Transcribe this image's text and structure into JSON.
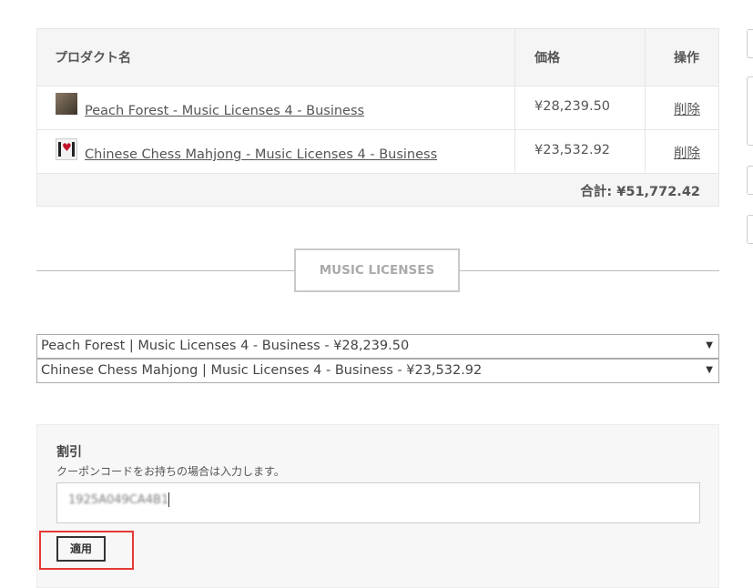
{
  "top_fragment": {
    "left": "",
    "right": ""
  },
  "cart": {
    "headers": {
      "product": "プロダクト名",
      "price": "価格",
      "action": "操作"
    },
    "items": [
      {
        "name": "Peach Forest - Music Licenses 4 - Business",
        "price": "¥28,239.50",
        "action": "削除"
      },
      {
        "name": "Chinese Chess Mahjong - Music Licenses 4 - Business",
        "price": "¥23,532.92",
        "action": "削除"
      }
    ],
    "total": "合計: ¥51,772.42"
  },
  "section": {
    "title": "MUSIC LICENSES"
  },
  "license_selects": [
    {
      "value": "Peach Forest | Music Licenses 4 - Business - ¥28,239.50"
    },
    {
      "value": "Chinese Chess Mahjong | Music Licenses 4 - Business - ¥23,532.92"
    }
  ],
  "discount": {
    "title": "割引",
    "hint": "クーポンコードをお持ちの場合は入力します。",
    "code_value": "1925A049CA4B1",
    "apply_label": "適用"
  },
  "colors": {
    "highlight": "#e53935",
    "border": "#e6e6e6",
    "text": "#555555"
  }
}
